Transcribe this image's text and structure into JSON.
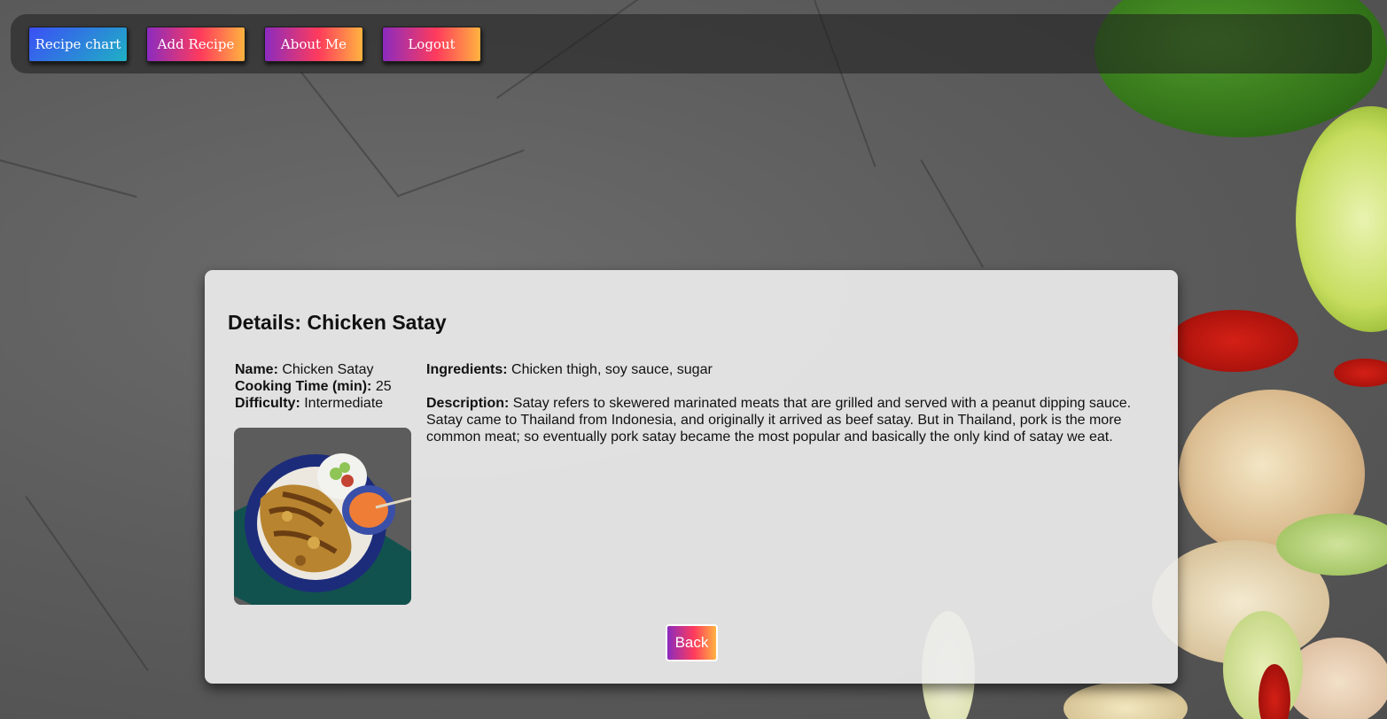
{
  "nav": {
    "items": [
      {
        "label": "Recipe chart"
      },
      {
        "label": "Add Recipe"
      },
      {
        "label": "About Me"
      },
      {
        "label": "Logout"
      }
    ]
  },
  "details": {
    "title": "Details: Chicken Satay",
    "name_label": "Name:",
    "name_value": " Chicken Satay",
    "time_label": "Cooking Time (min):",
    "time_value": " 25",
    "difficulty_label": "Difficulty:",
    "difficulty_value": " Intermediate",
    "ingredients_label": "Ingredients:",
    "ingredients_value": " Chicken thigh, soy sauce, sugar",
    "description_label": "Description:",
    "description_value": " Satay refers to skewered marinated meats that are grilled and served with a peanut dipping sauce. Satay came to Thailand from Indonesia, and originally it arrived as beef satay. But in Thailand, pork is the more common meat; so eventually pork satay became the most popular and basically the only kind of satay we eat.",
    "back_label": "Back"
  },
  "colors": {
    "active_nav": "#3b4ff6",
    "warm_gradient_start": "#8b2bbf",
    "warm_gradient_end": "#ffb340"
  }
}
